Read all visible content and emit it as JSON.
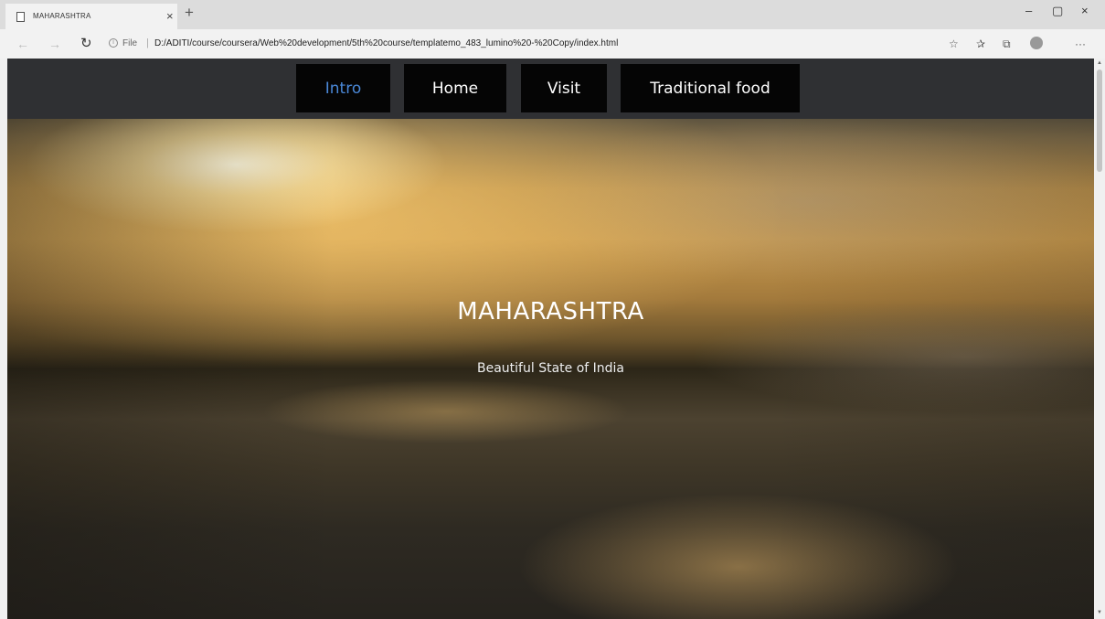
{
  "browser": {
    "tab_title": "MAHARASHTRA",
    "tab_close": "×",
    "new_tab": "+",
    "minimize": "–",
    "maximize": "▢",
    "close": "×",
    "back": "←",
    "forward": "→",
    "refresh": "↻",
    "info": "i",
    "address_prefix": "File",
    "address_separator": "|",
    "url": "D:/ADITI/course/coursera/Web%20development/5th%20course/templatemo_483_lumino%20-%20Copy/index.html",
    "icons": {
      "favorite": "☆",
      "favorites_bar": "✰",
      "collections": "⧉",
      "more": "···"
    }
  },
  "nav": {
    "items": [
      {
        "label": "Intro",
        "active": true
      },
      {
        "label": "Home",
        "active": false
      },
      {
        "label": "Visit",
        "active": false
      },
      {
        "label": "Traditional food",
        "active": false
      }
    ]
  },
  "hero": {
    "title": "MAHARASHTRA",
    "subtitle": "Beautiful State of India"
  },
  "colors": {
    "navbar_bg": "#2f3033",
    "nav_item_bg": "#050505",
    "nav_active_text": "#4a88d8",
    "nav_text": "#ffffff"
  },
  "scrollbar": {
    "up": "▲",
    "down": "▼"
  }
}
